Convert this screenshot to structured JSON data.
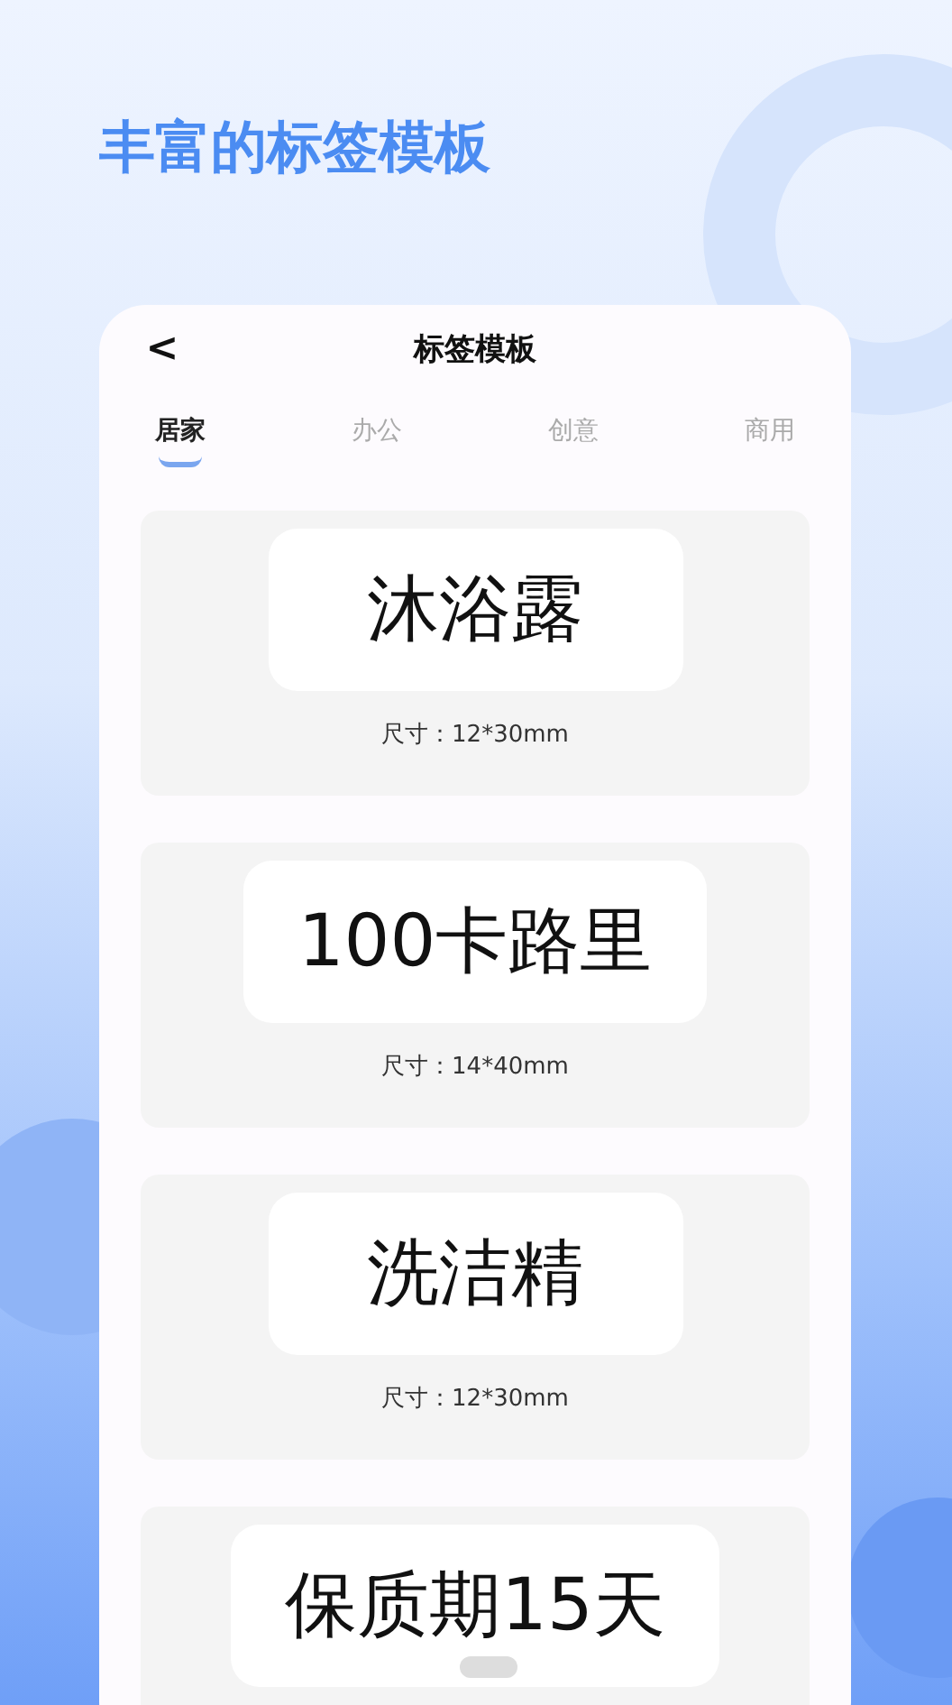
{
  "headline": "丰富的标签模板",
  "header": {
    "back": "<",
    "title": "标签模板"
  },
  "tabs": [
    {
      "label": "居家",
      "selected": true
    },
    {
      "label": "办公",
      "selected": false
    },
    {
      "label": "创意",
      "selected": false
    },
    {
      "label": "商用",
      "selected": false
    }
  ],
  "templates": [
    {
      "text": "沐浴露",
      "size": "尺寸：12*30mm"
    },
    {
      "text": "100卡路里",
      "size": "尺寸：14*40mm"
    },
    {
      "text": "洗洁精",
      "size": "尺寸：12*30mm"
    },
    {
      "text": "保质期15天"
    }
  ]
}
